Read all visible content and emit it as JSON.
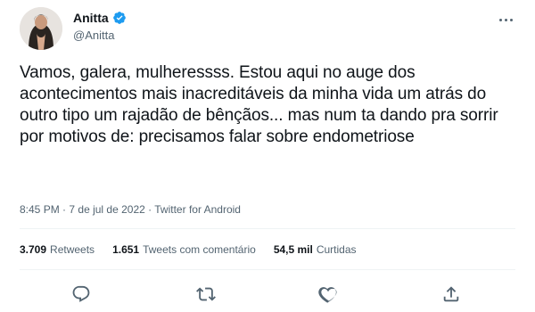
{
  "user": {
    "name": "Anitta",
    "handle": "@Anitta"
  },
  "tweet": {
    "text": "Vamos, galera, mulheressss. Estou aqui no auge dos acontecimentos mais inacreditáveis da minha vida um atrás do outro tipo um rajadão de bênçãos... mas num ta dando pra sorrir por motivos de: precisamos falar sobre endometriose",
    "time": "8:45 PM",
    "separator": "·",
    "date": "7 de jul de 2022",
    "source": "Twitter for Android"
  },
  "stats": {
    "retweets_count": "3.709",
    "retweets_label": "Retweets",
    "quotes_count": "1.651",
    "quotes_label": "Tweets com comentário",
    "likes_count": "54,5 mil",
    "likes_label": "Curtidas"
  },
  "colors": {
    "text": "#0f1419",
    "secondary": "#536471",
    "verified": "#1d9bf0",
    "divider": "#eff3f4"
  },
  "icons": {
    "more": "more-horizontal-icon",
    "verified": "verified-badge-icon",
    "reply": "reply-icon",
    "retweet": "retweet-icon",
    "like": "like-icon",
    "share": "share-icon"
  }
}
